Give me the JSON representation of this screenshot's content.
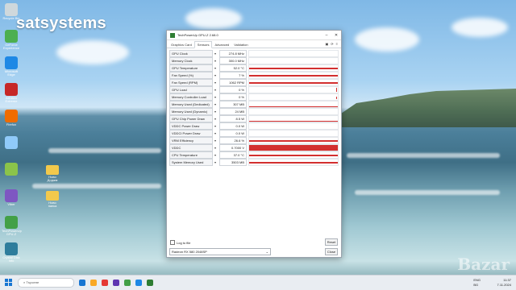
{
  "brand": "satsystems",
  "watermark": "Bazar",
  "desktop": {
    "left_icons": [
      {
        "label": "Recycle Bin",
        "color": "#cfd8dc"
      },
      {
        "label": "GeForce Experience",
        "color": "#4caf50"
      },
      {
        "label": "Microsoft Edge",
        "color": "#1e88e5"
      },
      {
        "label": "AIDA64 Extreme",
        "color": "#c62828"
      },
      {
        "label": "Firefox",
        "color": "#ef6c00"
      },
      {
        "label": "",
        "color": "#90caf9"
      },
      {
        "label": "",
        "color": "#8bc34a"
      },
      {
        "label": "Viber",
        "color": "#7e57c2"
      },
      {
        "label": "TechPowerUp GPU-Z",
        "color": "#43a047"
      },
      {
        "label": "Crystal Disk Info",
        "color": "#2e7d9c"
      }
    ],
    "folders": [
      {
        "label": "Ново\nДоджм"
      },
      {
        "label": "Ново\nпапка"
      }
    ]
  },
  "window": {
    "title": "TechPowerUp GPU-Z 2.68.0",
    "tabs": [
      "Graphics Card",
      "Sensors",
      "Advanced",
      "Validation"
    ],
    "active_tab": "Sensors",
    "tools": [
      "▣",
      "⟳",
      "≡"
    ],
    "sensors": [
      {
        "label": "GPU Clock",
        "value": "274.8 MHz",
        "graph": "none"
      },
      {
        "label": "Memory Clock",
        "value": "300.0 MHz",
        "graph": "none"
      },
      {
        "label": "GPU Temperature",
        "value": "52.0 °C",
        "graph": "line"
      },
      {
        "label": "Fan Speed (%)",
        "value": "7 %",
        "graph": "line"
      },
      {
        "label": "Fan Speed (RPM)",
        "value": "1062 RPM",
        "graph": "line"
      },
      {
        "label": "GPU Load",
        "value": "0 %",
        "graph": "spikes"
      },
      {
        "label": "Memory Controller Load",
        "value": "0 %",
        "graph": "spikes-small"
      },
      {
        "label": "Memory Used (Dedicated)",
        "value": "307 MB",
        "graph": "line-low"
      },
      {
        "label": "Memory Used (Dynamic)",
        "value": "24 MB",
        "graph": "none"
      },
      {
        "label": "GPU Chip Power Draw",
        "value": "8.5 W",
        "graph": "line-low"
      },
      {
        "label": "VDDC Power Draw",
        "value": "0.0 W",
        "graph": "none"
      },
      {
        "label": "VDDCI Power Draw",
        "value": "0.0 W",
        "graph": "none"
      },
      {
        "label": "VRM Efficiency",
        "value": "26.6 %",
        "graph": "line"
      },
      {
        "label": "VDDC",
        "value": "0.7000 V",
        "graph": "fill"
      },
      {
        "label": "CPU Temperature",
        "value": "37.0 °C",
        "graph": "line"
      },
      {
        "label": "System Memory Used",
        "value": "3503 MB",
        "graph": "line"
      }
    ],
    "log_label": "Log to file",
    "reset_label": "Reset",
    "gpu_select": "Radeon RX 580 2048SP",
    "close_label": "Close"
  },
  "taskbar": {
    "search_placeholder": "Търсене",
    "apps": [
      "#1976d2",
      "#f9a825",
      "#e53935",
      "#5e35b1",
      "#43a047",
      "#1e88e5",
      "#2e7d32"
    ],
    "lang": "ENG\nBG",
    "time": "11:37",
    "date": "7.11.2024"
  }
}
